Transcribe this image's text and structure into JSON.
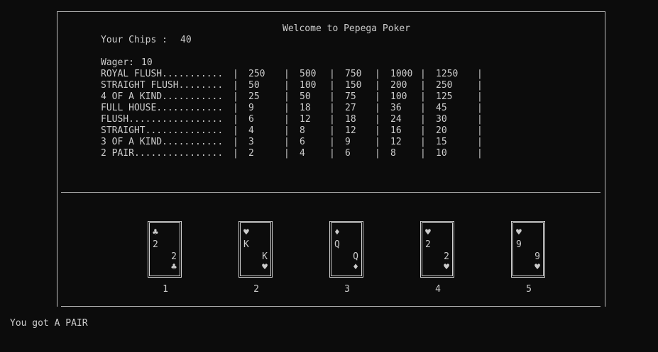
{
  "header": {
    "title": "Welcome to Pepega Poker",
    "chips_label": "Your Chips :",
    "chips_value": "40",
    "wager_label": "Wager:",
    "wager_value": "10"
  },
  "paytable": [
    {
      "hand": "ROYAL FLUSH...........",
      "payouts": [
        "250",
        "500",
        "750",
        "1000",
        "1250"
      ]
    },
    {
      "hand": "STRAIGHT FLUSH........",
      "payouts": [
        "50",
        "100",
        "150",
        "200",
        "250"
      ]
    },
    {
      "hand": "4 OF A KIND...........",
      "payouts": [
        "25",
        "50",
        "75",
        "100",
        "125"
      ]
    },
    {
      "hand": "FULL HOUSE............",
      "payouts": [
        "9",
        "18",
        "27",
        "36",
        "45"
      ]
    },
    {
      "hand": "FLUSH.................",
      "payouts": [
        "6",
        "12",
        "18",
        "24",
        "30"
      ]
    },
    {
      "hand": "STRAIGHT..............",
      "payouts": [
        "4",
        "8",
        "12",
        "16",
        "20"
      ]
    },
    {
      "hand": "3 OF A KIND...........",
      "payouts": [
        "3",
        "6",
        "9",
        "12",
        "15"
      ]
    },
    {
      "hand": "2 PAIR................",
      "payouts": [
        "2",
        "4",
        "6",
        "8",
        "10"
      ]
    }
  ],
  "cards": [
    {
      "rank": "2",
      "suit": "♣",
      "number": "1"
    },
    {
      "rank": "K",
      "suit": "♥",
      "number": "2"
    },
    {
      "rank": "Q",
      "suit": "♦",
      "number": "3"
    },
    {
      "rank": "2",
      "suit": "♥",
      "number": "4"
    },
    {
      "rank": "9",
      "suit": "♥",
      "number": "5"
    }
  ],
  "result_message": "You got A PAIR",
  "colors": {
    "background": "#0c0c0c",
    "text": "#cccccc"
  }
}
